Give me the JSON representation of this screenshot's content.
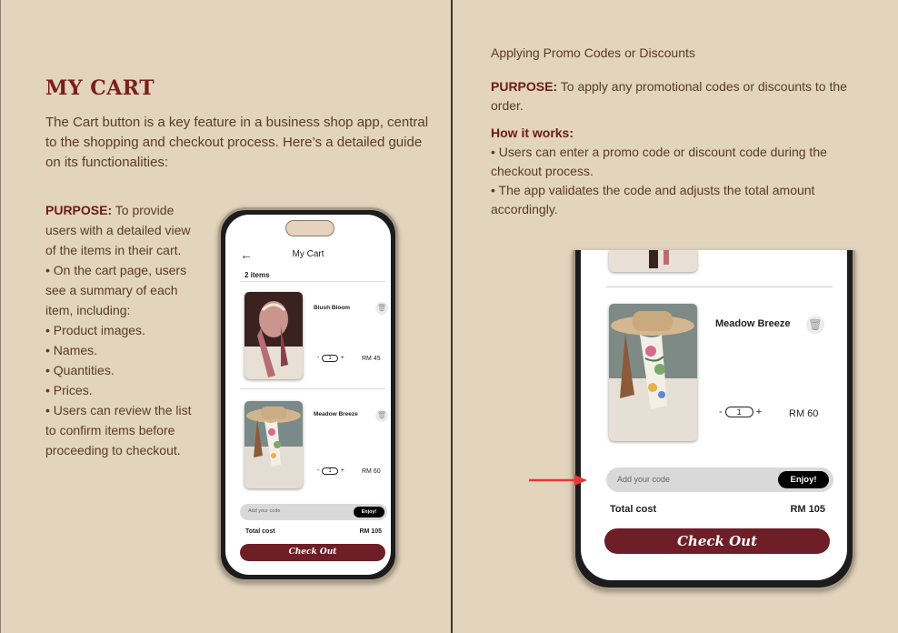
{
  "left": {
    "title": "MY CART",
    "intro": "The Cart button is a key feature in a business shop app, central to the shopping and checkout process. Here’s a detailed guide on its functionalities:",
    "purpose_label": "PURPOSE:",
    "purpose_text": " To provide users with a detailed view of the items in their cart.",
    "bullets": [
      "• On the cart page, users see a summary of each item, including:",
      "• Product images.",
      "• Names.",
      "• Quantities.",
      "• Prices.",
      "• Users can review the list to confirm items before proceeding to checkout."
    ]
  },
  "small_phone": {
    "back_icon": "arrow-left-icon",
    "title": "My Cart",
    "count": "2 items",
    "items": [
      {
        "name": "Blush Bloom",
        "qty": "1",
        "price": "RM 45"
      },
      {
        "name": "Meadow Breeze",
        "qty": "1",
        "price": "RM 60"
      }
    ],
    "promo_placeholder": "Add your code",
    "promo_button": "Enjoy!",
    "total_label": "Total cost",
    "total_value": "RM 105",
    "checkout_label": "Check Out"
  },
  "right": {
    "heading": "Applying Promo Codes or Discounts",
    "purpose_label": "PURPOSE:",
    "purpose_text": " To apply any promotional codes or discounts to the order.",
    "how_label": "How it works:",
    "how_1": " • Users can enter a promo code or discount code during the checkout process.",
    "how_2": " • The app validates the code and adjusts the total amount accordingly."
  },
  "big_phone": {
    "item_name": "Meadow Breeze",
    "qty": "1",
    "price": "RM 60",
    "promo_placeholder": "Add your code",
    "promo_button": "Enjoy!",
    "total_label": "Total cost",
    "total_value": "RM 105",
    "checkout_label": "Check Out"
  },
  "colors": {
    "page": "#e3d4bd",
    "accent": "#7a1e1e",
    "checkout": "#6e1e26",
    "arrow": "#e53935"
  }
}
